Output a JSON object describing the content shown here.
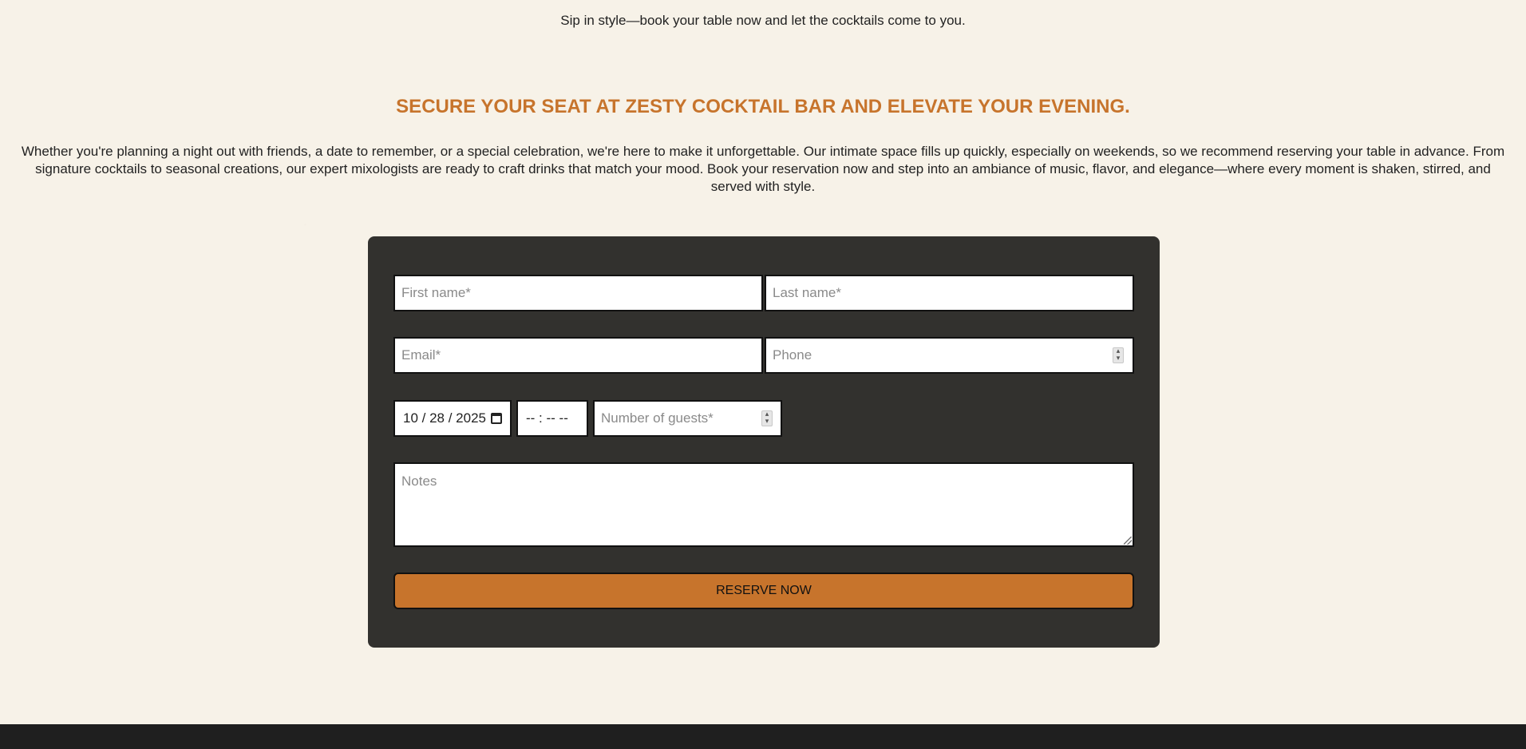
{
  "hero": {
    "tagline": "Sip in style—book your table now and let the cocktails come to you.",
    "heading": "SECURE YOUR SEAT AT ZESTY COCKTAIL BAR AND ELEVATE YOUR EVENING.",
    "intro": "Whether you're planning a night out with friends, a date to remember, or a special celebration, we're here to make it unforgettable. Our intimate space fills up quickly, especially on weekends, so we recommend reserving your table in advance. From signature cocktails to seasonal creations, our expert mixologists are ready to craft drinks that match your mood. Book your reservation now and step into an ambiance of music, flavor, and elegance—where every moment is shaken, stirred, and served with style."
  },
  "form": {
    "first_name_placeholder": "First name*",
    "last_name_placeholder": "Last name*",
    "email_placeholder": "Email*",
    "phone_placeholder": "Phone",
    "date_value": "10 / 28 / 2025",
    "time_value": "-- : --  --",
    "guests_placeholder": "Number of guests*",
    "notes_placeholder": "Notes",
    "submit_label": "RESERVE NOW"
  },
  "colors": {
    "accent": "#c7742c",
    "panel": "#32312e",
    "background": "#f7f2e8",
    "footer": "#1f1f1f"
  },
  "icons": {
    "date_picker": "calendar-icon",
    "number_spinner": "spinner-icon"
  }
}
